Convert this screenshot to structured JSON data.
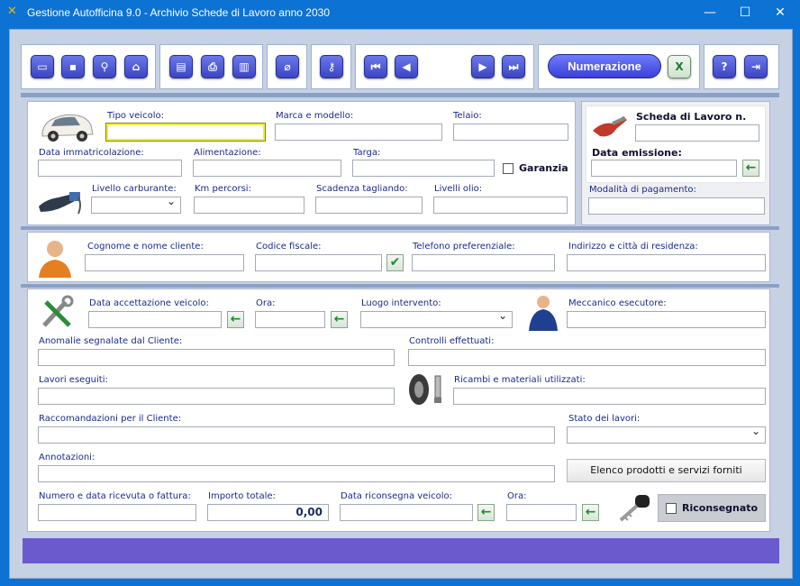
{
  "window": {
    "title": "Gestione Autofficina 9.0 - Archivio Schede di Lavoro anno 2030",
    "minimize": "—",
    "maximize": "☐",
    "close": "✕"
  },
  "toolbar": {
    "numerazione_label": "Numerazione",
    "excel_label": "X"
  },
  "vehicle": {
    "tipo_veicolo_label": "Tipo veicolo:",
    "marca_modello_label": "Marca e modello:",
    "telaio_label": "Telaio:",
    "data_immatricolazione_label": "Data immatricolazione:",
    "alimentazione_label": "Alimentazione:",
    "targa_label": "Targa:",
    "garanzia_label": "Garanzia",
    "livello_carburante_label": "Livello carburante:",
    "km_percorsi_label": "Km percorsi:",
    "scadenza_tagliando_label": "Scadenza tagliando:",
    "livelli_olio_label": "Livelli olio:"
  },
  "scheda": {
    "numero_label": "Scheda di Lavoro n.",
    "data_emissione_label": "Data emissione:",
    "modalita_pagamento_label": "Modalità di pagamento:"
  },
  "cliente": {
    "cognome_nome_label": "Cognome e nome cliente:",
    "codice_fiscale_label": "Codice fiscale:",
    "telefono_label": "Telefono preferenziale:",
    "indirizzo_label": "Indirizzo e città di residenza:"
  },
  "intervento": {
    "data_accettazione_label": "Data accettazione veicolo:",
    "ora_label": "Ora:",
    "luogo_label": "Luogo intervento:",
    "meccanico_label": "Meccanico esecutore:",
    "anomalie_label": "Anomalie segnalate dal Cliente:",
    "controlli_label": "Controlli effettuati:",
    "lavori_label": "Lavori eseguiti:",
    "ricambi_label": "Ricambi e materiali utilizzati:",
    "raccomandazioni_label": "Raccomandazioni per il Cliente:",
    "stato_lavori_label": "Stato dei lavori:",
    "annotazioni_label": "Annotazioni:",
    "elenco_button": "Elenco prodotti e servizi forniti",
    "ricevuta_label": "Numero e data ricevuta o fattura:",
    "importo_label": "Importo totale:",
    "importo_value": "0,00",
    "data_riconsegna_label": "Data riconsegna veicolo:",
    "ora_riconsegna_label": "Ora:",
    "riconsegnato_label": "Riconsegnato"
  },
  "colors": {
    "window_blue": "#0c72d3",
    "accent_purple": "#6a5acd",
    "button_blue": "#3b45c4"
  }
}
